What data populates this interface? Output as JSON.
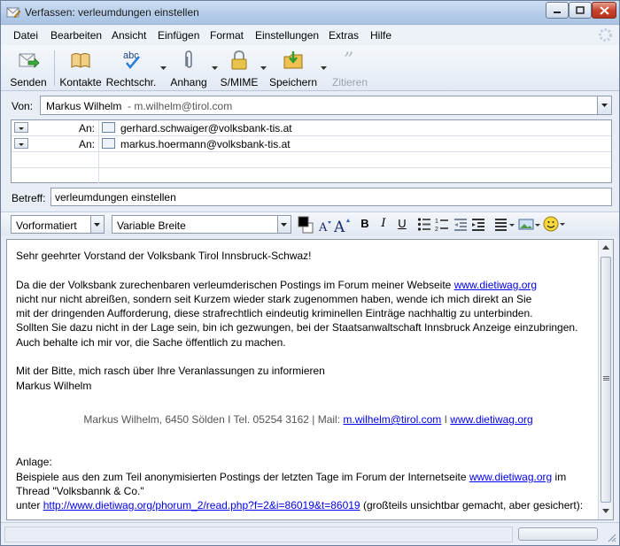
{
  "window": {
    "title": "Verfassen: verleumdungen einstellen"
  },
  "menu": [
    {
      "label": "Datei"
    },
    {
      "label": "Bearbeiten"
    },
    {
      "label": "Ansicht"
    },
    {
      "label": "Einfügen"
    },
    {
      "label": "Format"
    },
    {
      "label": "Einstellungen"
    },
    {
      "label": "Extras"
    },
    {
      "label": "Hilfe"
    }
  ],
  "toolbar": {
    "send": "Senden",
    "contacts": "Kontakte",
    "spell": "Rechtschr.",
    "attach": "Anhang",
    "smime": "S/MIME",
    "save": "Speichern",
    "quote": "Zitieren"
  },
  "header": {
    "from_label": "Von:",
    "from_name": "Markus Wilhelm",
    "from_email": "- m.wilhelm@tirol.com",
    "recipients": [
      {
        "type": "An:",
        "address": "gerhard.schwaiger@volksbank-tis.at"
      },
      {
        "type": "An:",
        "address": "markus.hoermann@volksbank-tis.at"
      }
    ],
    "subject_label": "Betreff:",
    "subject": "verleumdungen einstellen"
  },
  "format": {
    "paragraph": "Vorformatiert",
    "font": "Variable Breite"
  },
  "body": {
    "greeting": "Sehr geehrter Vorstand der Volksbank Tirol Innsbruck-Schwaz!",
    "p1_a": "Da die der Volksbank zurechenbaren verleumderischen Postings im Forum meiner Webseite ",
    "p1_link": "www.dietiwag.org",
    "p1_l2": "nicht nur nicht abreißen, sondern seit Kurzem wieder stark zugenommen haben, wende ich mich direkt an Sie",
    "p1_l3": "mit der dringenden Aufforderung, diese strafrechtlich eindeutig kriminellen Einträge nachhaltig zu unterbinden.",
    "p1_l4": "Sollten Sie dazu nicht in der Lage sein, bin ich gezwungen, bei der Staatsanwaltschaft Innsbruck Anzeige einzubringen.",
    "p1_l5": "Auch behalte ich mir vor, die Sache öffentlich zu machen.",
    "closing": "Mit der Bitte, mich rasch über Ihre Veranlassungen zu informieren",
    "signer": "Markus Wilhelm",
    "sig_text": "Markus Wilhelm, 6450 Sölden I  Tel. 05254 3162  |  Mail: ",
    "sig_mail": "m.wilhelm@tirol.com",
    "sig_sep": " I  ",
    "sig_web": "www.dietiwag.org",
    "att_label": "Anlage:",
    "att_l1a": "Beispiele aus den zum Teil anonymisierten Postings der letzten Tage im Forum der Internetseite ",
    "att_l1_link": "www.dietiwag.org",
    "att_l1b": " im",
    "att_l2": "Thread \"Volksbannk & Co.\"",
    "att_l3a": "unter ",
    "att_l3_link": "http://www.dietiwag.org/phorum_2/read.php?f=2&i=86019&t=86019",
    "att_l3b": " (großteils unsichtbar gemacht, aber gesichert):"
  }
}
